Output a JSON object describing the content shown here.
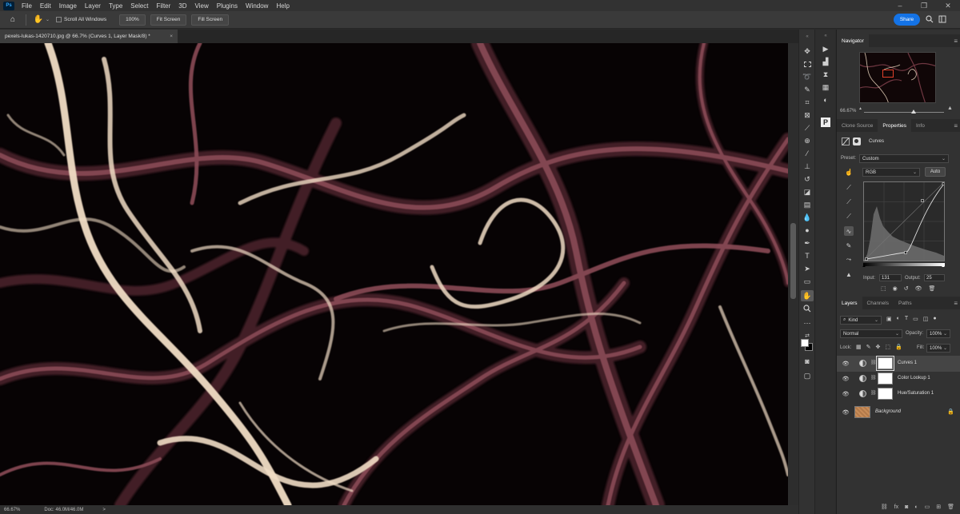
{
  "menubar": {
    "app_icon": "Ps",
    "items": [
      "File",
      "Edit",
      "Image",
      "Layer",
      "Type",
      "Select",
      "Filter",
      "3D",
      "View",
      "Plugins",
      "Window",
      "Help"
    ],
    "window_controls": [
      "–",
      "❐",
      "✕"
    ]
  },
  "options": {
    "home_icon": "home-icon",
    "hand_icon": "hand-icon",
    "scroll_all_label": "Scroll All Windows",
    "zoom_btn": "100%",
    "fit_btn": "Fit Screen",
    "fill_btn": "Fill Screen",
    "share_label": "Share"
  },
  "document": {
    "tab_title": "pexels-lukas-1420710.jpg @ 66.7% (Curves 1, Layer Mask/8) *",
    "close": "×"
  },
  "status": {
    "zoom": "66.67%",
    "doc_size": "Doc: 46.0M/46.0M",
    "arrow": ">"
  },
  "navigator": {
    "title": "Navigator",
    "zoom": "66.67%",
    "zoom_level": 0.62
  },
  "properties": {
    "tabs": [
      "Clone Source",
      "Properties",
      "Info"
    ],
    "active_tab": "Properties",
    "header_label": "Curves",
    "preset_label": "Preset:",
    "preset_value": "Custom",
    "channel_value": "RGB",
    "auto_label": "Auto",
    "input_label": "Input:",
    "input_value": "131",
    "output_label": "Output:",
    "output_value": "25"
  },
  "layers_panel": {
    "tabs": [
      "Layers",
      "Channels",
      "Paths"
    ],
    "active_tab": "Layers",
    "kind_label": "Kind",
    "blend_mode": "Normal",
    "opacity_label": "Opacity:",
    "opacity_value": "100%",
    "lock_label": "Lock:",
    "fill_label": "Fill:",
    "fill_value": "100%",
    "layers": [
      {
        "name": "Curves 1",
        "selected": true
      },
      {
        "name": "Color Lookup 1",
        "selected": false
      },
      {
        "name": "Hue/Saturation 1",
        "selected": false
      },
      {
        "name": "Background",
        "selected": false
      }
    ]
  },
  "colors": {
    "accent": "#1473e6",
    "canvas_bg": "#070304",
    "fiber_light": "#f0dcc4",
    "fiber_mid": "#8a4b56",
    "fiber_dark": "#4a2029"
  }
}
